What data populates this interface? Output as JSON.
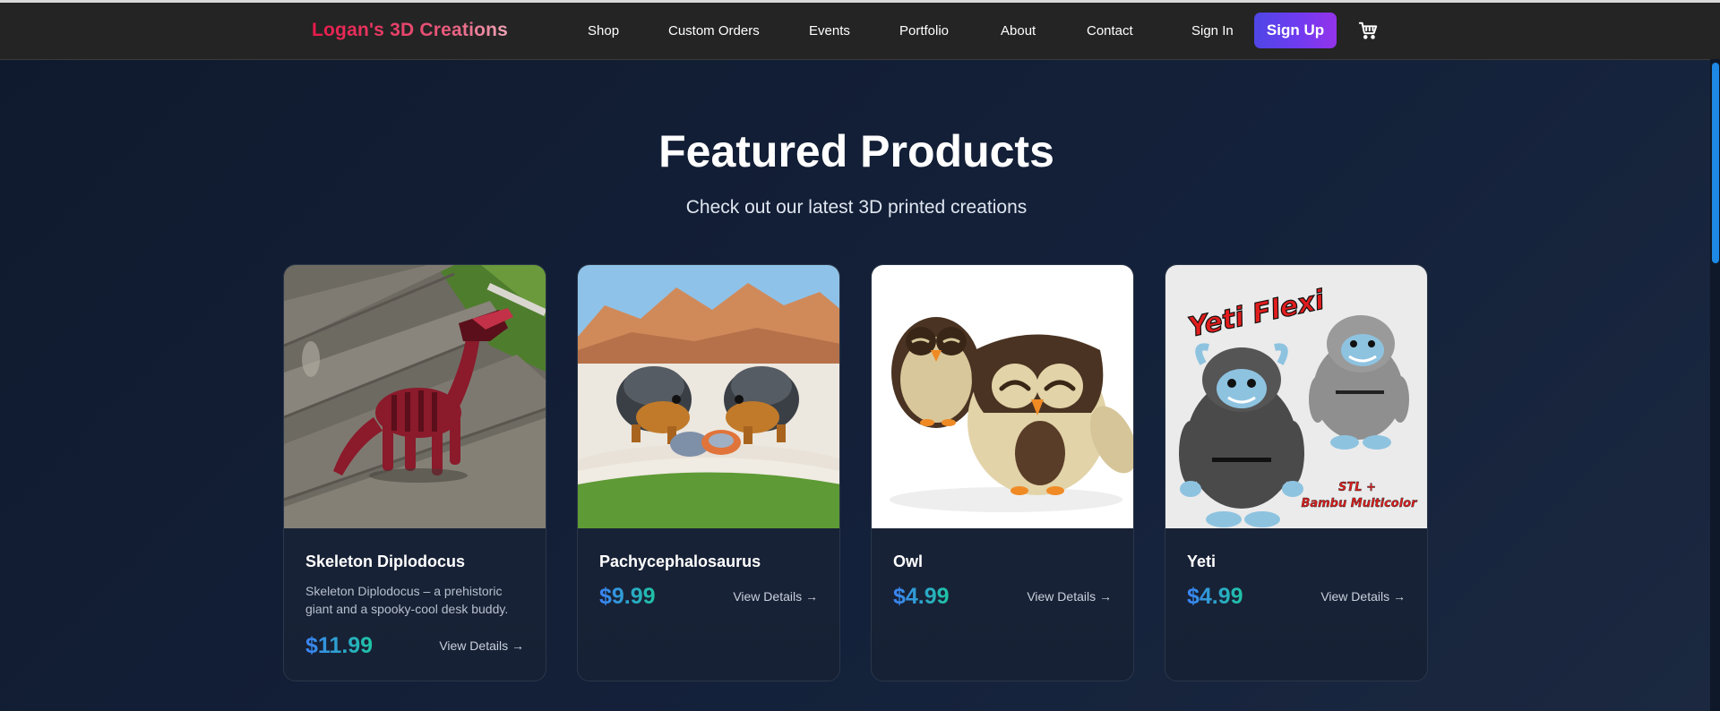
{
  "nav": {
    "logo": "Logan's 3D Creations",
    "links": [
      "Shop",
      "Custom Orders",
      "Events",
      "Portfolio",
      "About",
      "Contact"
    ],
    "sign_in": "Sign In",
    "sign_up": "Sign Up",
    "cart_icon": "cart-icon"
  },
  "featured": {
    "title": "Featured Products",
    "subtitle": "Check out our latest 3D printed creations",
    "cta_label": "View Details →",
    "products": [
      {
        "name": "Skeleton Diplodocus",
        "description": "Skeleton Diplodocus – a prehistoric giant and a spooky-cool desk buddy.",
        "price": "$11.99"
      },
      {
        "name": "Pachycephalosaurus",
        "description": "",
        "price": "$9.99"
      },
      {
        "name": "Owl",
        "description": "",
        "price": "$4.99"
      },
      {
        "name": "Yeti",
        "description": "",
        "price": "$4.99",
        "image_text": [
          "Yeti Flexi",
          "STL +",
          "Bambu Multicolor"
        ]
      }
    ]
  },
  "colors": {
    "background": "#121c30",
    "navbar": "#242424",
    "logo_accent": "#e8194a",
    "signup_start": "#4f46e5",
    "signup_end": "#9333ea",
    "price_start": "#3b82f6",
    "price_end": "#1fc4a4",
    "scrollbar": "#1e88e5"
  }
}
